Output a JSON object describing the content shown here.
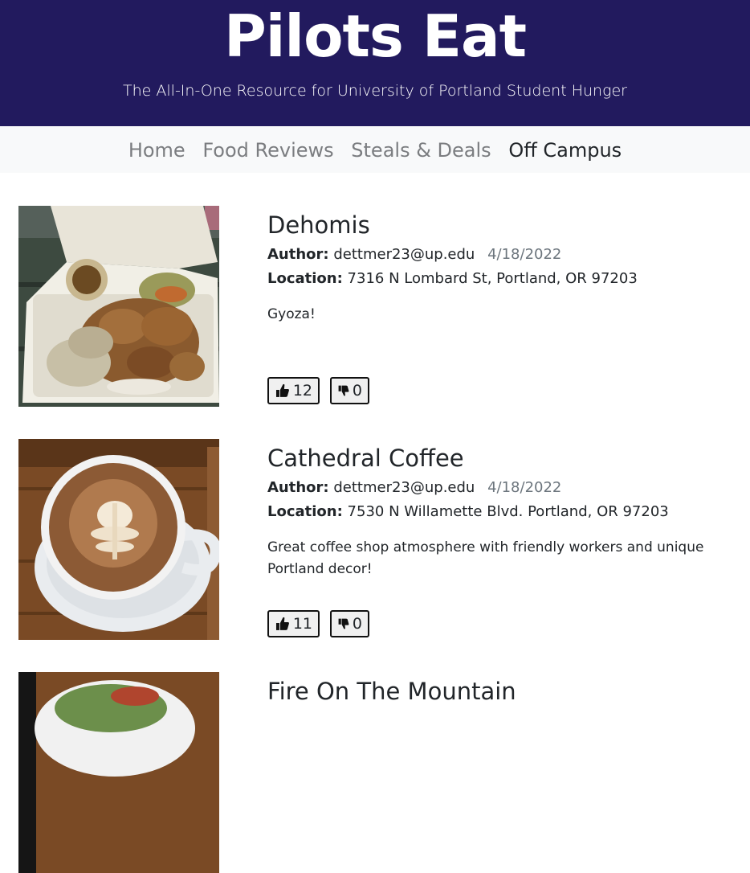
{
  "header": {
    "title": "Pilots Eat",
    "subtitle": "The All-In-One Resource for University of Portland Student Hunger"
  },
  "nav": {
    "items": [
      {
        "label": "Home",
        "active": false
      },
      {
        "label": "Food Reviews",
        "active": false
      },
      {
        "label": "Steals & Deals",
        "active": false
      },
      {
        "label": "Off Campus",
        "active": true
      }
    ]
  },
  "labels": {
    "author": "Author:",
    "location": "Location:"
  },
  "posts": [
    {
      "title": "Dehomis",
      "author": "dettmer23@up.edu",
      "date": "4/18/2022",
      "location": "7316 N Lombard St, Portland, OR 97203",
      "description": "Gyoza!",
      "likes": "12",
      "dislikes": "0"
    },
    {
      "title": "Cathedral Coffee",
      "author": "dettmer23@up.edu",
      "date": "4/18/2022",
      "location": "7530 N Willamette Blvd. Portland, OR 97203",
      "description": "Great coffee shop atmosphere with friendly workers and unique Portland decor!",
      "likes": "11",
      "dislikes": "0"
    },
    {
      "title": "Fire On The Mountain"
    }
  ],
  "colors": {
    "header_bg": "#221a5e",
    "nav_bg": "#f8f9fa",
    "nav_inactive": "#7b7d80",
    "nav_active": "#212529"
  }
}
